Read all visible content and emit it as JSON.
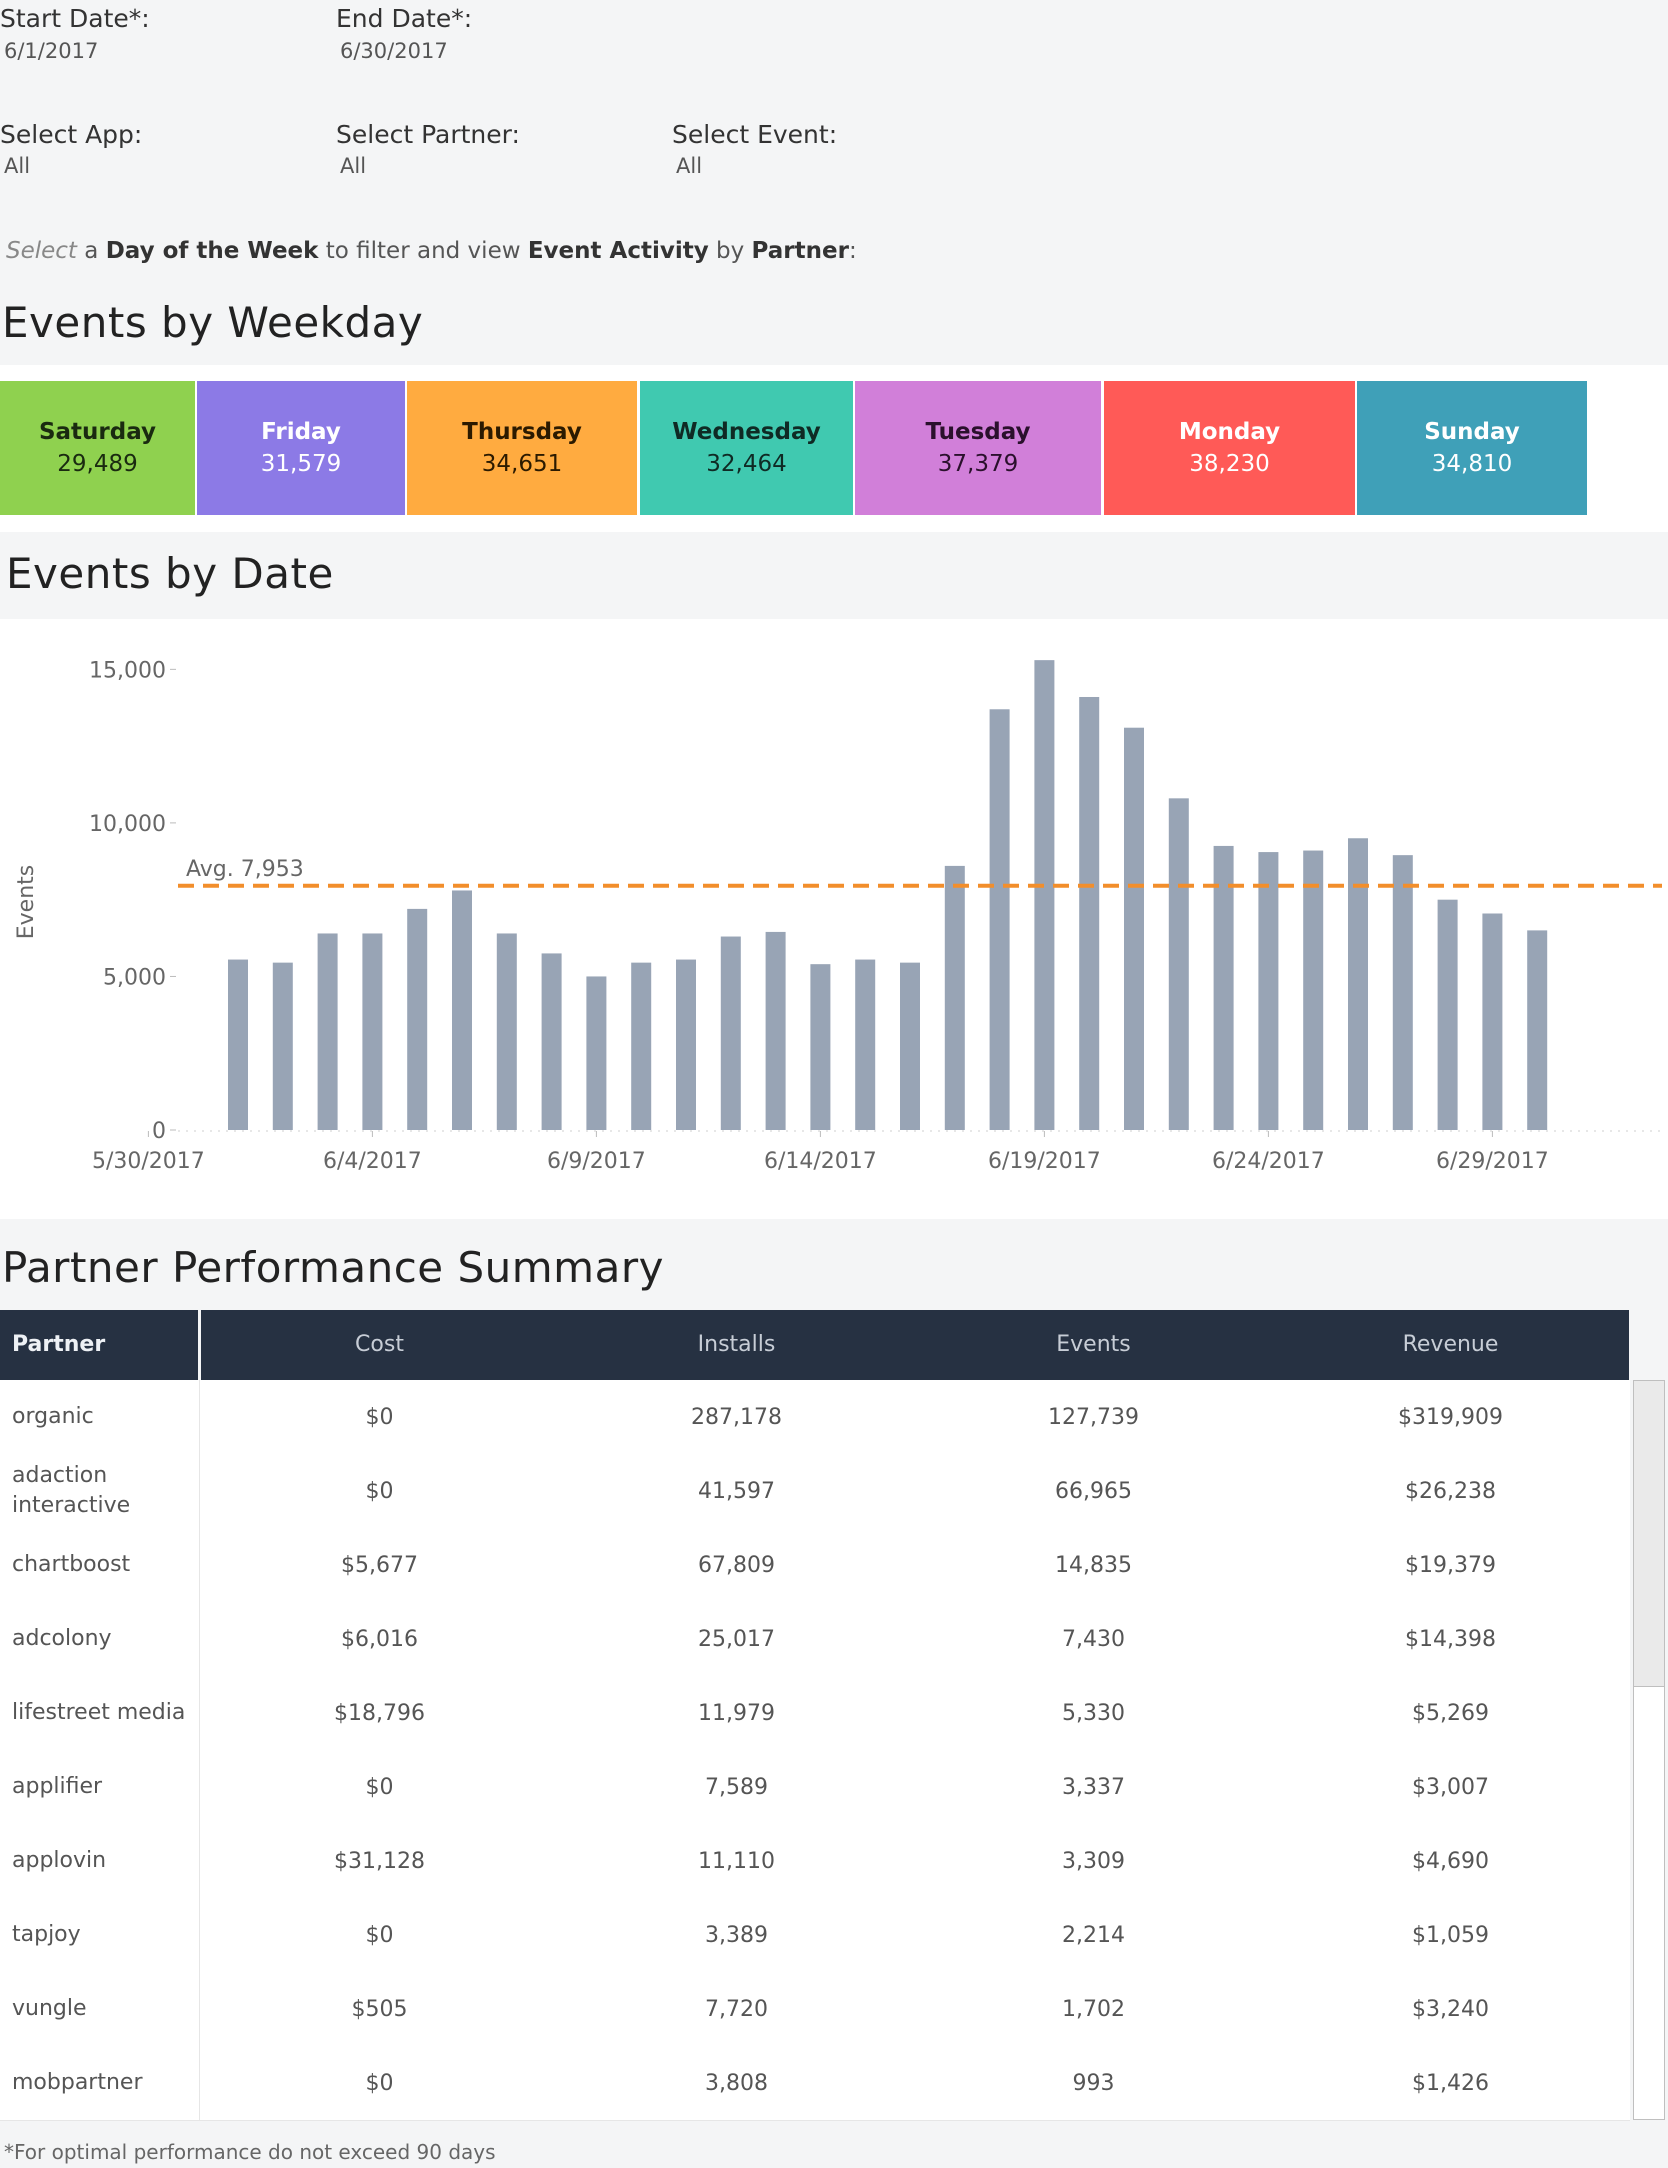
{
  "filters": {
    "start_date": {
      "label": "Start Date*:",
      "value": "6/1/2017"
    },
    "end_date": {
      "label": "End Date*:",
      "value": "6/30/2017"
    },
    "app": {
      "label": "Select App:",
      "value": "All"
    },
    "partner": {
      "label": "Select Partner:",
      "value": "All"
    },
    "event": {
      "label": "Select Event:",
      "value": "All"
    }
  },
  "instruction": {
    "w1": "Select",
    "w2": "a",
    "w3": "Day of the Week",
    "w4": "to filter and view",
    "w5": "Event Activity",
    "w6": "by",
    "w7": "Partner",
    "w8": ":"
  },
  "weekday_section": {
    "title": "Events by Weekday",
    "days": [
      {
        "name": "Saturday",
        "value": "29,489",
        "color": "#8fd14f",
        "text_color": "#1a2a10"
      },
      {
        "name": "Friday",
        "value": "31,579",
        "color": "#8c7ae6",
        "text_color": "#ffffff"
      },
      {
        "name": "Thursday",
        "value": "34,651",
        "color": "#ffab40",
        "text_color": "#2b1a00"
      },
      {
        "name": "Wednesday",
        "value": "32,464",
        "color": "#40c9b0",
        "text_color": "#0f2a24"
      },
      {
        "name": "Tuesday",
        "value": "37,379",
        "color": "#d17fd9",
        "text_color": "#2a102c"
      },
      {
        "name": "Monday",
        "value": "38,230",
        "color": "#ff5a57",
        "text_color": "#ffffff"
      },
      {
        "name": "Sunday",
        "value": "34,810",
        "color": "#3fa0b8",
        "text_color": "#ffffff"
      }
    ]
  },
  "date_section": {
    "title": "Events by Date"
  },
  "chart_data": {
    "type": "bar",
    "ylabel": "Events",
    "ylim": [
      0,
      15500
    ],
    "yticks": [
      {
        "v": 0,
        "label": "0"
      },
      {
        "v": 5000,
        "label": "5,000"
      },
      {
        "v": 10000,
        "label": "10,000"
      },
      {
        "v": 15000,
        "label": "15,000"
      }
    ],
    "xticks": [
      "5/30/2017",
      "6/4/2017",
      "6/9/2017",
      "6/14/2017",
      "6/19/2017",
      "6/24/2017",
      "6/29/2017"
    ],
    "x_start": "5/30/2017",
    "x": [
      "6/1/2017",
      "6/2/2017",
      "6/3/2017",
      "6/4/2017",
      "6/5/2017",
      "6/6/2017",
      "6/7/2017",
      "6/8/2017",
      "6/9/2017",
      "6/10/2017",
      "6/11/2017",
      "6/12/2017",
      "6/13/2017",
      "6/14/2017",
      "6/15/2017",
      "6/16/2017",
      "6/17/2017",
      "6/18/2017",
      "6/19/2017",
      "6/20/2017",
      "6/21/2017",
      "6/22/2017",
      "6/23/2017",
      "6/24/2017",
      "6/25/2017",
      "6/26/2017",
      "6/27/2017",
      "6/28/2017",
      "6/29/2017",
      "6/30/2017"
    ],
    "values": [
      5550,
      5450,
      6400,
      6400,
      7200,
      7800,
      6400,
      5750,
      5000,
      5450,
      5550,
      6300,
      6450,
      5400,
      5550,
      5450,
      8600,
      13700,
      15300,
      14100,
      13100,
      10800,
      9250,
      9050,
      9100,
      9500,
      8950,
      7500,
      7050,
      6500
    ],
    "average": {
      "value": 7953,
      "label": "Avg. 7,953",
      "color": "#f28e2b"
    },
    "bar_color": "#98a4b5"
  },
  "table": {
    "title": "Partner Performance Summary",
    "headers": {
      "partner": "Partner",
      "cost": "Cost",
      "installs": "Installs",
      "events": "Events",
      "revenue": "Revenue"
    },
    "rows": [
      {
        "partner": "organic",
        "cost": "$0",
        "installs": "287,178",
        "events": "127,739",
        "revenue": "$319,909"
      },
      {
        "partner": "adaction interactive",
        "cost": "$0",
        "installs": "41,597",
        "events": "66,965",
        "revenue": "$26,238"
      },
      {
        "partner": "chartboost",
        "cost": "$5,677",
        "installs": "67,809",
        "events": "14,835",
        "revenue": "$19,379"
      },
      {
        "partner": "adcolony",
        "cost": "$6,016",
        "installs": "25,017",
        "events": "7,430",
        "revenue": "$14,398"
      },
      {
        "partner": "lifestreet media",
        "cost": "$18,796",
        "installs": "11,979",
        "events": "5,330",
        "revenue": "$5,269"
      },
      {
        "partner": "applifier",
        "cost": "$0",
        "installs": "7,589",
        "events": "3,337",
        "revenue": "$3,007"
      },
      {
        "partner": "applovin",
        "cost": "$31,128",
        "installs": "11,110",
        "events": "3,309",
        "revenue": "$4,690"
      },
      {
        "partner": "tapjoy",
        "cost": "$0",
        "installs": "3,389",
        "events": "2,214",
        "revenue": "$1,059"
      },
      {
        "partner": "vungle",
        "cost": "$505",
        "installs": "7,720",
        "events": "1,702",
        "revenue": "$3,240"
      },
      {
        "partner": "mobpartner",
        "cost": "$0",
        "installs": "3,808",
        "events": "993",
        "revenue": "$1,426"
      }
    ]
  },
  "footnote": "*For optimal performance do not exceed 90 days"
}
